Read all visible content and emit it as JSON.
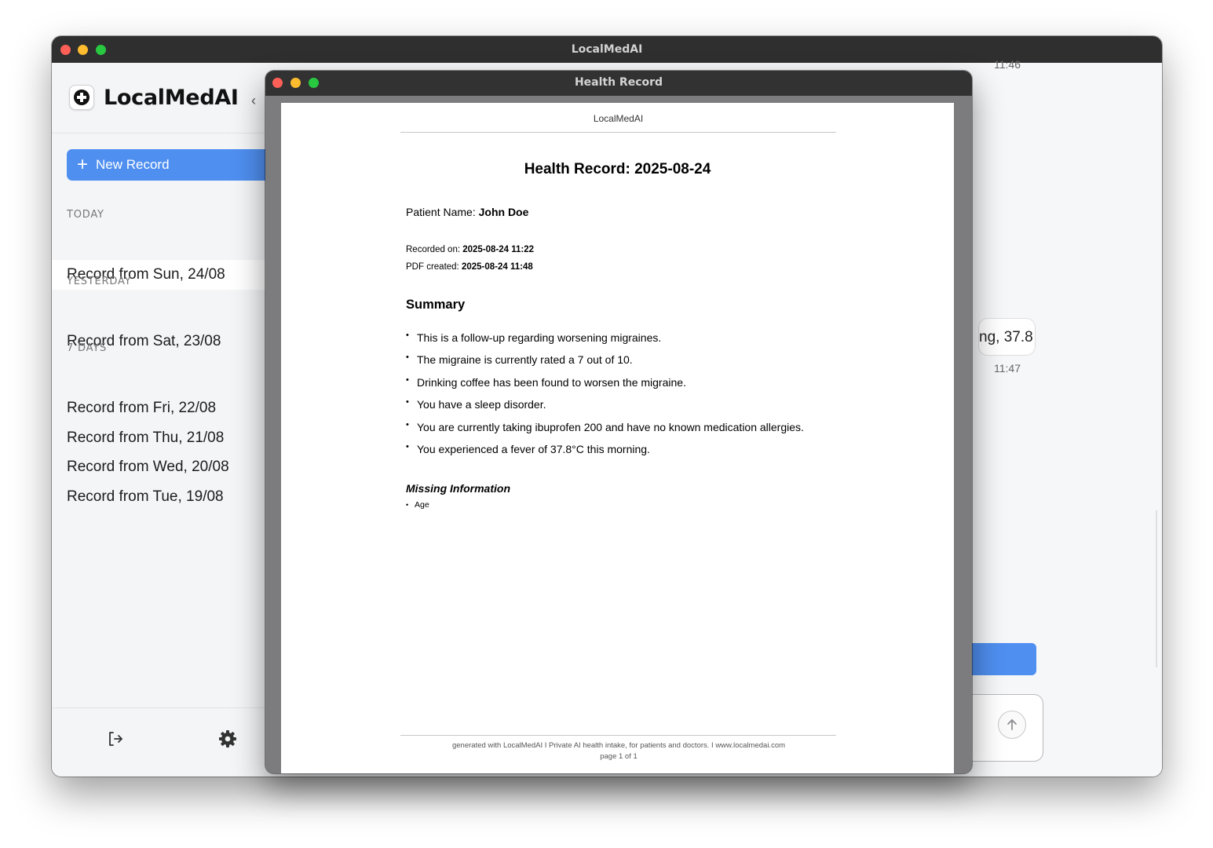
{
  "main_window": {
    "title": "LocalMedAI"
  },
  "sidebar": {
    "brand": "LocalMedAI",
    "collapse_glyph": "‹",
    "new_record_label": "New Record",
    "sections": [
      {
        "label": "TODAY",
        "items": [
          "Record from Sun, 24/08"
        ]
      },
      {
        "label": "YESTERDAY",
        "items": [
          "Record from Sat, 23/08"
        ]
      },
      {
        "label": "7 DAYS",
        "items": [
          "Record from Fri, 22/08",
          "Record from Thu, 21/08",
          "Record from Wed, 20/08",
          "Record from Tue, 19/08"
        ]
      }
    ],
    "icons": {
      "logo": "medical-cross-icon",
      "logout": "logout-icon",
      "settings": "gear-icon"
    }
  },
  "chat": {
    "timestamp_top": "11:46",
    "bubble_text": "ng, 37.8",
    "timestamp_bubble": "11:47",
    "send_icon": "arrow-up-icon"
  },
  "pdf_window": {
    "title": "Health Record",
    "doc": {
      "header": "LocalMedAI",
      "title": "Health Record: 2025-08-24",
      "patient_label": "Patient Name: ",
      "patient_name": "John Doe",
      "recorded_label": "Recorded on: ",
      "recorded_value": "2025-08-24 11:22",
      "pdf_created_label": "PDF created: ",
      "pdf_created_value": "2025-08-24 11:48",
      "summary_heading": "Summary",
      "summary_items": [
        "This is a follow-up regarding worsening migraines.",
        "The migraine is currently rated a 7 out of 10.",
        "Drinking coffee has been found to worsen the migraine.",
        "You have a sleep disorder.",
        "You are currently taking ibuprofen 200 and have no known medication allergies.",
        "You experienced a fever of 37.8°C this morning."
      ],
      "missing_heading": "Missing Information",
      "missing_items": [
        "Age"
      ],
      "footer_line1": "generated with LocalMedAI  I  Private AI health intake, for patients and doctors.  I  www.localmedai.com",
      "footer_line2": "page 1 of 1"
    }
  },
  "colors": {
    "accent": "#4f8ff0",
    "titlebar": "#2f2f30",
    "traffic_red": "#fe5f57",
    "traffic_yellow": "#febc2e",
    "traffic_green": "#28c840"
  }
}
